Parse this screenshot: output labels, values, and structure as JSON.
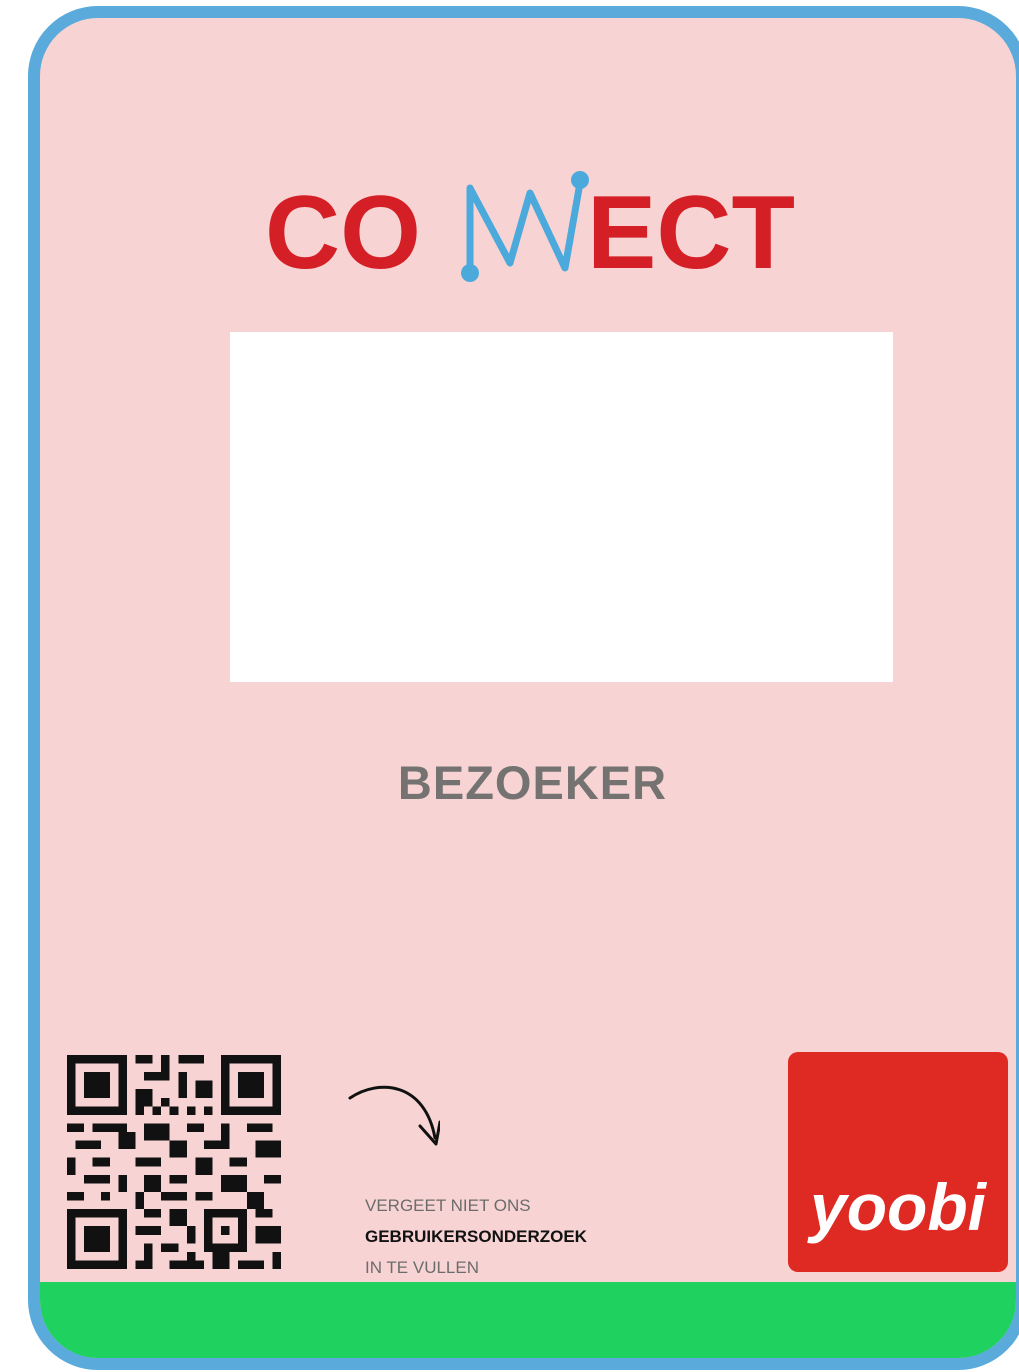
{
  "badge": {
    "colors": {
      "border": "#5aaadb",
      "background": "#f7d4d3",
      "footer_bar": "#1fd15f",
      "logo_red": "#d41f26",
      "logo_blue": "#4ca9dc",
      "role_text": "#757272"
    },
    "event_logo": {
      "text": "CONNECT",
      "icon": "connect-n-network-icon"
    },
    "photo_placeholder": "white-photo-area",
    "role": "BEZOEKER",
    "qr_code": {
      "icon": "qr-code-icon"
    },
    "arrow": {
      "icon": "curved-arrow-icon"
    },
    "survey_note": {
      "line1": "VERGEET NIET ONS",
      "line2": "GEBRUIKERSONDERZOEK",
      "line3": "IN TE VULLEN"
    },
    "brand_logo": {
      "text": "yoobi",
      "color": "#de2a22"
    }
  }
}
